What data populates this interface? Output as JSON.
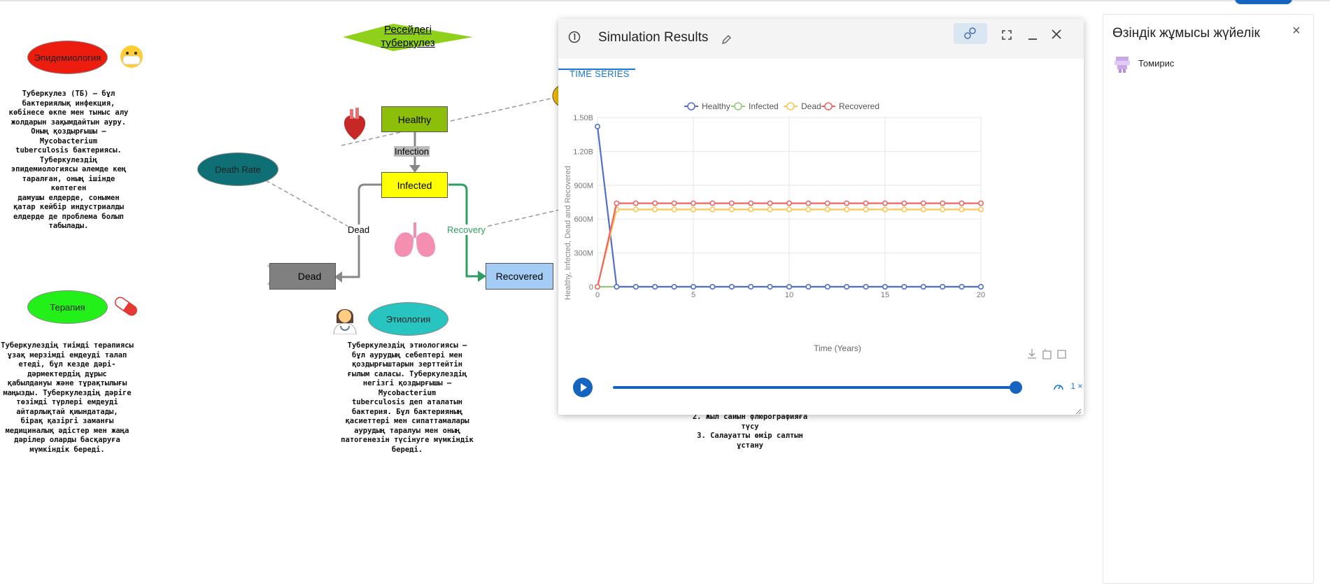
{
  "diagram": {
    "title": "Ресейдегі туберкулез",
    "nodes": {
      "epidemiology": "Эпидемиология",
      "therapy": "Терапия",
      "etiology": "Этиология",
      "death_rate": "Death Rate",
      "healthy": "Healthy",
      "infected": "Infected",
      "dead": "Dead",
      "recovered": "Recovered"
    },
    "edge_labels": {
      "infection": "Infection",
      "dead": "Dead",
      "recovery": "Recovery"
    },
    "texts": {
      "epidemiology": [
        "Туберкулез (ТБ) – бұл",
        "бактериялық инфекция,",
        "көбінесе өкпе мен тыныс алу",
        "жолдарын зақымдайтын ауру.",
        "Оның қоздырғышы –",
        "Mycobacterium",
        "tuberculosis бактериясы.",
        "Туберкулездің",
        "эпидемиологиясы әлемде кең",
        "таралған, оның ішінде көптеген",
        "дамушы елдерде, сонымен",
        "қатар кейбір индустриалды",
        "елдерде де проблема болып",
        "табылады."
      ],
      "therapy": [
        "Туберкулездің тиімді терапиясы",
        "ұзақ мерзімді емдеуді талап",
        "етеді, бұл кезде дәрі-",
        "дәрмектердің дұрыс",
        "қабылдануы және тұрақтылығы",
        "маңызды. Туберкулездің дәріге",
        "төзімді түрлері емдеуді",
        "айтарлықтай қиындатады,",
        "бірақ қазіргі заманғы",
        "медициналық әдістер мен жаңа",
        "дәрілер оларды басқаруға",
        "мүмкіндік береді."
      ],
      "etiology": [
        "Туберкулездің этиологиясы –",
        "бұл аурудың себептері мен",
        "қоздырғыштарын зерттейтін",
        "ғылым саласы. Туберкулездің",
        "негізгі қоздырғышы –",
        "Mycobacterium",
        "tuberculosis деп аталатын",
        "бактерия. Бұл бактерияның",
        "қасиеттері мен сипаттамалары",
        "аурудың таралуы мен оның",
        "патогенезін түсінуге мүмкіндік",
        "береді."
      ],
      "prevention_fragment": [
        "2. Жыл сайын флюрографияға",
        "түсу",
        "3. Салауатты өмір салтын",
        "ұстану"
      ]
    },
    "icons": {
      "heart": "anatomical-heart",
      "lungs": "lungs",
      "skull": "skull-crossbones",
      "doctor": "health-worker",
      "mask": "face-with-mask",
      "pill": "pill"
    }
  },
  "simulation": {
    "window_title": "Simulation Results",
    "tab": "TIME SERIES",
    "speed_label": "1 ×",
    "playback_progress": 1.0
  },
  "chart_data": {
    "type": "line",
    "x": [
      0,
      1,
      2,
      3,
      4,
      5,
      6,
      7,
      8,
      9,
      10,
      11,
      12,
      13,
      14,
      15,
      16,
      17,
      18,
      19,
      20
    ],
    "xlabel": "Time (Years)",
    "ylabel": "Healthy, Infected, Dead and Recovered",
    "xlim": [
      0,
      20
    ],
    "ylim": [
      0,
      1500000000
    ],
    "xticks": [
      0,
      5,
      10,
      15,
      20
    ],
    "ytick_values": [
      0,
      300000000,
      600000000,
      900000000,
      1200000000,
      1500000000
    ],
    "ytick_labels": [
      "0",
      "300M",
      "600M",
      "900M",
      "1.20B",
      "1.50B"
    ],
    "grid": true,
    "legend_position": "top",
    "series": [
      {
        "name": "Healthy",
        "color": "#5470c6",
        "values": [
          1420000000,
          0,
          0,
          0,
          0,
          0,
          0,
          0,
          0,
          0,
          0,
          0,
          0,
          0,
          0,
          0,
          0,
          0,
          0,
          0,
          0
        ]
      },
      {
        "name": "Infected",
        "color": "#91cc75",
        "values": [
          0,
          0,
          0,
          0,
          0,
          0,
          0,
          0,
          0,
          0,
          0,
          0,
          0,
          0,
          0,
          0,
          0,
          0,
          0,
          0,
          0
        ]
      },
      {
        "name": "Dead",
        "color": "#fac858",
        "values": [
          0,
          685000000,
          685000000,
          685000000,
          685000000,
          685000000,
          685000000,
          685000000,
          685000000,
          685000000,
          685000000,
          685000000,
          685000000,
          685000000,
          685000000,
          685000000,
          685000000,
          685000000,
          685000000,
          685000000,
          685000000
        ]
      },
      {
        "name": "Recovered",
        "color": "#ee6666",
        "values": [
          0,
          740000000,
          740000000,
          740000000,
          740000000,
          740000000,
          740000000,
          740000000,
          740000000,
          740000000,
          740000000,
          740000000,
          740000000,
          740000000,
          740000000,
          740000000,
          740000000,
          740000000,
          740000000,
          740000000,
          740000000
        ]
      }
    ]
  },
  "panel": {
    "title": "Өзіндік жұмысы жүйелік",
    "user": "Томирис"
  }
}
